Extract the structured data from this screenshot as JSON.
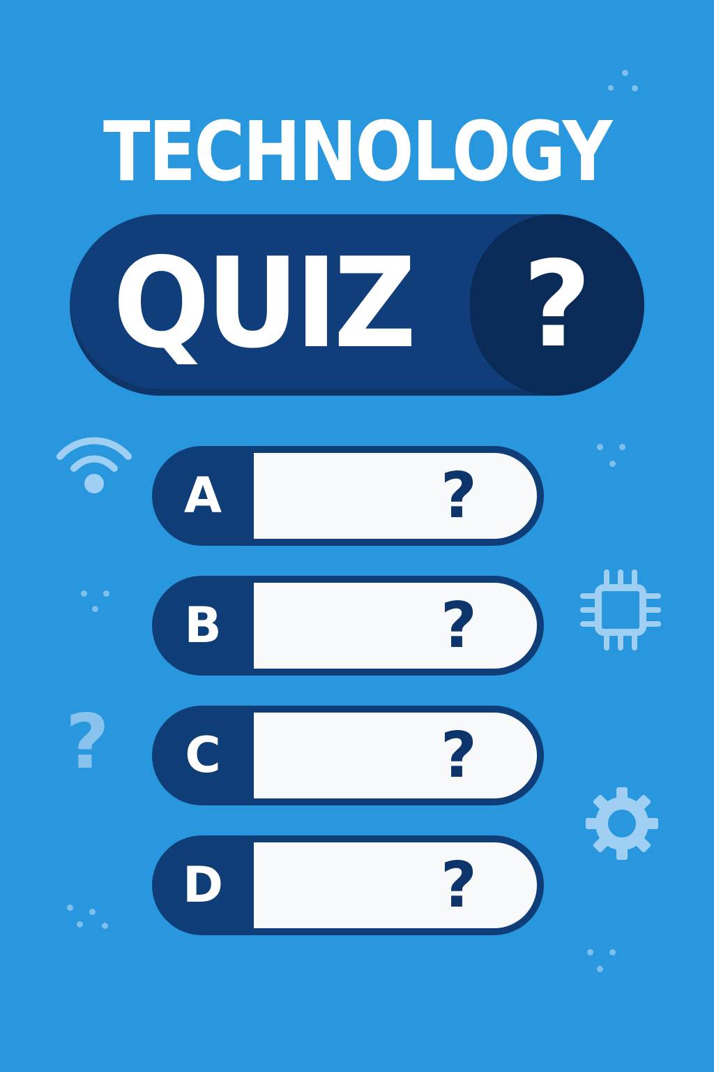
{
  "title": "TECHNOLOGY",
  "quiz": {
    "label": "QUIZ",
    "badge": "?"
  },
  "answers": [
    {
      "letter": "A",
      "placeholder": "?"
    },
    {
      "letter": "B",
      "placeholder": "?"
    },
    {
      "letter": "C",
      "placeholder": "?"
    },
    {
      "letter": "D",
      "placeholder": "?"
    }
  ],
  "decorations": {
    "question_mark": "?",
    "icons": [
      "wifi-icon",
      "chip-icon",
      "gear-icon"
    ]
  },
  "colors": {
    "background": "#2897de",
    "navy": "#103e7a",
    "dark_navy": "#0a2a57",
    "white": "#ffffff",
    "accent_light": "#a7d3f4"
  }
}
